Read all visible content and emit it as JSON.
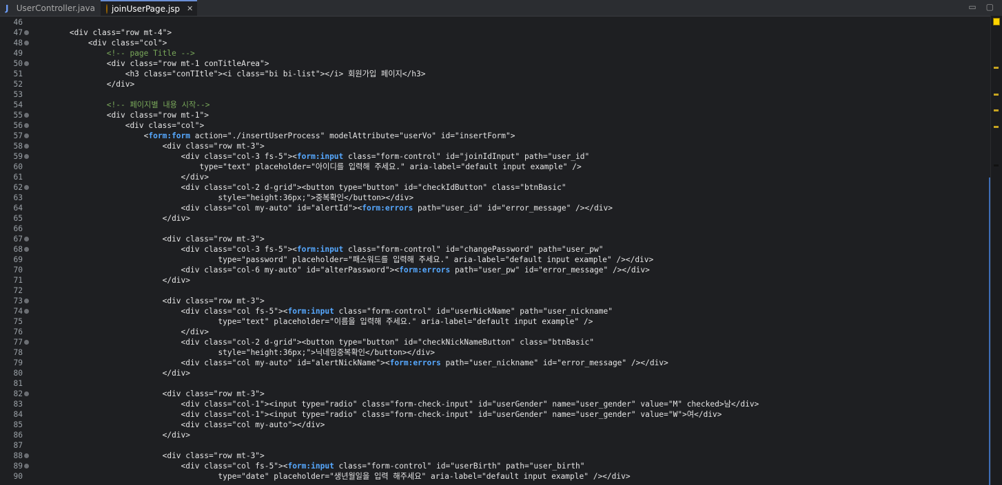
{
  "tabs": [
    {
      "label": "UserController.java",
      "icon": "java-file-icon",
      "active": false
    },
    {
      "label": "joinUserPage.jsp",
      "icon": "jsp-file-icon",
      "active": true
    }
  ],
  "editor": {
    "first_line": 46,
    "lines": [
      {
        "n": "46",
        "fold": false,
        "segs": []
      },
      {
        "n": "47",
        "fold": true,
        "segs": [
          [
            "tg",
            "        <div class=\"row mt-4\">"
          ]
        ]
      },
      {
        "n": "48",
        "fold": true,
        "segs": [
          [
            "tg",
            "            <div class=\"col\">"
          ]
        ]
      },
      {
        "n": "49",
        "fold": false,
        "segs": [
          [
            "cm",
            "                <!-- page Title -->"
          ]
        ]
      },
      {
        "n": "50",
        "fold": true,
        "segs": [
          [
            "tg",
            "                <div class=\"row mt-1 conTitleArea\">"
          ]
        ]
      },
      {
        "n": "51",
        "fold": false,
        "segs": [
          [
            "tg",
            "                    <h3 class=\"conTItle\"><i class=\"bi bi-list\"></i> 회원가입 페이지</h3>"
          ]
        ]
      },
      {
        "n": "52",
        "fold": false,
        "segs": [
          [
            "tg",
            "                </div>"
          ]
        ]
      },
      {
        "n": "53",
        "fold": false,
        "segs": []
      },
      {
        "n": "54",
        "fold": false,
        "segs": [
          [
            "cm",
            "                <!-- 페이지별 내용 시작-->"
          ]
        ]
      },
      {
        "n": "55",
        "fold": true,
        "segs": [
          [
            "tg",
            "                <div class=\"row mt-1\">"
          ]
        ]
      },
      {
        "n": "56",
        "fold": true,
        "segs": [
          [
            "tg",
            "                    <div class=\"col\">"
          ]
        ]
      },
      {
        "n": "57",
        "fold": true,
        "segs": [
          [
            "tg",
            "                        <"
          ],
          [
            "ns",
            "form:form"
          ],
          [
            "tg",
            " action=\"./insertUserProcess\" modelAttribute=\"userVo\" id=\"insertForm\">"
          ]
        ]
      },
      {
        "n": "58",
        "fold": true,
        "segs": [
          [
            "tg",
            "                            <div class=\"row mt-3\">"
          ]
        ]
      },
      {
        "n": "59",
        "fold": true,
        "segs": [
          [
            "tg",
            "                                <div class=\"col-3 fs-5\"><"
          ],
          [
            "ns",
            "form:input"
          ],
          [
            "tg",
            " class=\"form-control\" id=\"joinIdInput\" path=\"user_id\""
          ]
        ]
      },
      {
        "n": "60",
        "fold": false,
        "segs": [
          [
            "tg",
            "                                    type=\"text\" placeholder=\"아이디를 입력해 주세요.\" aria-label=\"default input example\" />"
          ]
        ]
      },
      {
        "n": "61",
        "fold": false,
        "segs": [
          [
            "tg",
            "                                </div>"
          ]
        ]
      },
      {
        "n": "62",
        "fold": true,
        "segs": [
          [
            "tg",
            "                                <div class=\"col-2 d-grid\"><button type=\"button\" id=\"checkIdButton\" class=\"btnBasic\""
          ]
        ]
      },
      {
        "n": "63",
        "fold": false,
        "segs": [
          [
            "tg",
            "                                        style=\"height:36px;\">중복확인</button></div>"
          ]
        ]
      },
      {
        "n": "64",
        "fold": false,
        "segs": [
          [
            "tg",
            "                                <div class=\"col my-auto\" id=\"alertId\"><"
          ],
          [
            "ns",
            "form:errors"
          ],
          [
            "tg",
            " path=\"user_id\" id=\"error_message\" /></div>"
          ]
        ]
      },
      {
        "n": "65",
        "fold": false,
        "segs": [
          [
            "tg",
            "                            </div>"
          ]
        ]
      },
      {
        "n": "66",
        "fold": false,
        "segs": []
      },
      {
        "n": "67",
        "fold": true,
        "segs": [
          [
            "tg",
            "                            <div class=\"row mt-3\">"
          ]
        ]
      },
      {
        "n": "68",
        "fold": true,
        "segs": [
          [
            "tg",
            "                                <div class=\"col-3 fs-5\"><"
          ],
          [
            "ns",
            "form:input"
          ],
          [
            "tg",
            " class=\"form-control\" id=\"changePassword\" path=\"user_pw\""
          ]
        ]
      },
      {
        "n": "69",
        "fold": false,
        "segs": [
          [
            "tg",
            "                                        type=\"password\" placeholder=\"패스워드를 입력해 주세요.\" aria-label=\"default input example\" /></div>"
          ]
        ]
      },
      {
        "n": "70",
        "fold": false,
        "segs": [
          [
            "tg",
            "                                <div class=\"col-6 my-auto\" id=\"alterPassword\"><"
          ],
          [
            "ns",
            "form:errors"
          ],
          [
            "tg",
            " path=\"user_pw\" id=\"error_message\" /></div>"
          ]
        ]
      },
      {
        "n": "71",
        "fold": false,
        "segs": [
          [
            "tg",
            "                            </div>"
          ]
        ]
      },
      {
        "n": "72",
        "fold": false,
        "segs": []
      },
      {
        "n": "73",
        "fold": true,
        "segs": [
          [
            "tg",
            "                            <div class=\"row mt-3\">"
          ]
        ]
      },
      {
        "n": "74",
        "fold": true,
        "segs": [
          [
            "tg",
            "                                <div class=\"col fs-5\"><"
          ],
          [
            "ns",
            "form:input"
          ],
          [
            "tg",
            " class=\"form-control\" id=\"userNickName\" path=\"user_nickname\""
          ]
        ]
      },
      {
        "n": "75",
        "fold": false,
        "segs": [
          [
            "tg",
            "                                        type=\"text\" placeholder=\"이름을 입력해 주세요.\" aria-label=\"default input example\" />"
          ]
        ]
      },
      {
        "n": "76",
        "fold": false,
        "segs": [
          [
            "tg",
            "                                </div>"
          ]
        ]
      },
      {
        "n": "77",
        "fold": true,
        "segs": [
          [
            "tg",
            "                                <div class=\"col-2 d-grid\"><button type=\"button\" id=\"checkNickNameButton\" class=\"btnBasic\""
          ]
        ]
      },
      {
        "n": "78",
        "fold": false,
        "segs": [
          [
            "tg",
            "                                        style=\"height:36px;\">닉네임중복확인</button></div>"
          ]
        ]
      },
      {
        "n": "79",
        "fold": false,
        "segs": [
          [
            "tg",
            "                                <div class=\"col my-auto\" id=\"alertNickName\"><"
          ],
          [
            "ns",
            "form:errors"
          ],
          [
            "tg",
            " path=\"user_nickname\" id=\"error_message\" /></div>"
          ]
        ]
      },
      {
        "n": "80",
        "fold": false,
        "segs": [
          [
            "tg",
            "                            </div>"
          ]
        ]
      },
      {
        "n": "81",
        "fold": false,
        "segs": []
      },
      {
        "n": "82",
        "fold": true,
        "segs": [
          [
            "tg",
            "                            <div class=\"row mt-3\">"
          ]
        ]
      },
      {
        "n": "83",
        "fold": false,
        "segs": [
          [
            "tg",
            "                                <div class=\"col-1\"><input type=\"radio\" class=\"form-check-input\" id=\"userGender\" name=\"user_gender\" value=\"M\" checked>남</div>"
          ]
        ]
      },
      {
        "n": "84",
        "fold": false,
        "segs": [
          [
            "tg",
            "                                <div class=\"col-1\"><input type=\"radio\" class=\"form-check-input\" id=\"userGender\" name=\"user_gender\" value=\"W\">여</div>"
          ]
        ]
      },
      {
        "n": "85",
        "fold": false,
        "segs": [
          [
            "tg",
            "                                <div class=\"col my-auto\"></div>"
          ]
        ]
      },
      {
        "n": "86",
        "fold": false,
        "segs": [
          [
            "tg",
            "                            </div>"
          ]
        ]
      },
      {
        "n": "87",
        "fold": false,
        "segs": []
      },
      {
        "n": "88",
        "fold": true,
        "segs": [
          [
            "tg",
            "                            <div class=\"row mt-3\">"
          ]
        ]
      },
      {
        "n": "89",
        "fold": true,
        "segs": [
          [
            "tg",
            "                                <div class=\"col fs-5\"><"
          ],
          [
            "ns",
            "form:input"
          ],
          [
            "tg",
            " class=\"form-control\" id=\"userBirth\" path=\"user_birth\""
          ]
        ]
      },
      {
        "n": "90",
        "fold": false,
        "segs": [
          [
            "tg",
            "                                        type=\"date\" placeholder=\"생년월일을 입력 해주세요\" aria-label=\"default input example\" /></div>"
          ]
        ]
      }
    ]
  },
  "colors": {
    "background": "#1e1f22",
    "namespace_tag": "#56a8ff",
    "comment": "#79a85a",
    "warning_marker": "#c7a420"
  }
}
